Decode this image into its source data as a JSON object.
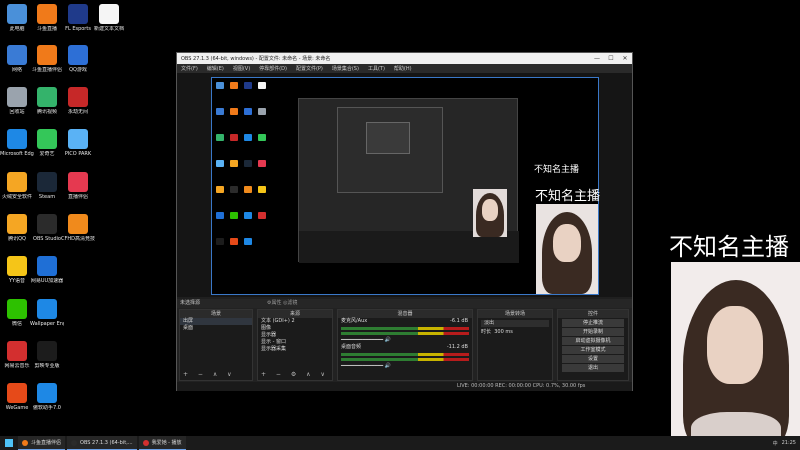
{
  "desktop": {
    "icons": [
      {
        "label": "此电脑",
        "color": "#4a90d9"
      },
      {
        "label": "斗鱼直播",
        "color": "#f07a1a"
      },
      {
        "label": "FL Esports",
        "color": "#1f3a8a"
      },
      {
        "label": "新建文本文档",
        "color": "#f5f5f5"
      },
      {
        "label": "网络",
        "color": "#3a7bd5"
      },
      {
        "label": "斗鱼直播伴侣",
        "color": "#f07a1a"
      },
      {
        "label": "QQ游戏",
        "color": "#2d6fd6"
      },
      {
        "label": "回收站",
        "color": "#9aa3ad"
      },
      {
        "label": "腾讯视频",
        "color": "#34b36b"
      },
      {
        "label": "永劫无间",
        "color": "#c62828"
      },
      {
        "label": "Microsoft Edge",
        "color": "#1e88e5"
      },
      {
        "label": "爱奇艺",
        "color": "#34c759"
      },
      {
        "label": "PICO PARK",
        "color": "#5ab2f5"
      },
      {
        "label": "火绒安全软件",
        "color": "#f5a623"
      },
      {
        "label": "Steam",
        "color": "#1b2838"
      },
      {
        "label": "直播伴侣",
        "color": "#e53950"
      },
      {
        "label": "腾讯QQ",
        "color": "#f5a623"
      },
      {
        "label": "OBS Studio",
        "color": "#2b2b2b"
      },
      {
        "label": "CFHD高清竞技大区",
        "color": "#f08a1c"
      },
      {
        "label": "YY语音",
        "color": "#f5c518"
      },
      {
        "label": "网易UU加速器",
        "color": "#1f6fd6"
      },
      {
        "label": "微信",
        "color": "#2dc100"
      },
      {
        "label": "Wallpaper Engine：...",
        "color": "#1e88e5"
      },
      {
        "label": "网易云音乐",
        "color": "#d32f2f"
      },
      {
        "label": "剪映专业版",
        "color": "#1c1c1c"
      },
      {
        "label": "WeGame",
        "color": "#e64a19"
      },
      {
        "label": "傲软助手7.0",
        "color": "#1e88e5"
      }
    ]
  },
  "obs": {
    "title": "OBS 27.1.3 (64-bit, windows) - 配置文件: 未命名 - 场景: 未命名",
    "menu": [
      "文件(F)",
      "编辑(E)",
      "视图(V)",
      "停靠部件(D)",
      "配置文件(P)",
      "场景集合(S)",
      "工具(T)",
      "帮助(H)"
    ],
    "window_buttons": {
      "minimize": "—",
      "maximize": "☐",
      "close": "✕"
    },
    "scene_bar": {
      "label": "未选择源",
      "props": "⚙属性  ◎滤镜"
    },
    "docks": {
      "scenes": {
        "title": "场景",
        "items": [
          "出屏",
          "桌面"
        ]
      },
      "sources": {
        "title": "来源",
        "items": [
          "文本 (GDI+) 2",
          "图像",
          "显示器",
          "显示 - 窗口",
          "显示器采集"
        ]
      },
      "mixer": {
        "title": "混音器",
        "tracks": [
          {
            "name": "麦克风/Aux",
            "db": "-6.1 dB"
          },
          {
            "name": "桌面音频",
            "db": "-11.2 dB"
          }
        ]
      },
      "transitions": {
        "title": "场景转场",
        "type": "淡出",
        "duration_label": "时长",
        "duration": "300 ms"
      },
      "controls": {
        "title": "控件",
        "buttons": [
          "停止推流",
          "开始录制",
          "启动虚拟摄像机",
          "工作室模式",
          "设置",
          "退出"
        ]
      }
    },
    "status": "LIVE: 00:00:00   REC: 00:00:00   CPU: 0.7%, 30.00 fps"
  },
  "captions": {
    "inner": "不知名主播",
    "small": "不知名主播",
    "big": "不知名主播"
  },
  "taskbar": {
    "items": [
      {
        "label": "斗鱼直播伴侣",
        "color": "#f07a1a"
      },
      {
        "label": "OBS 27.1.3 (64-bit,...",
        "color": "#2b2b2b"
      },
      {
        "label": "我爱她 - 播放",
        "color": "#d32f2f"
      }
    ],
    "tray": {
      "lang": "中",
      "time": "21:25"
    }
  },
  "colors": {
    "obs_bg": "#1f1f1f",
    "canvas_border": "#3a78c8",
    "accent": "#6aa0e8"
  }
}
